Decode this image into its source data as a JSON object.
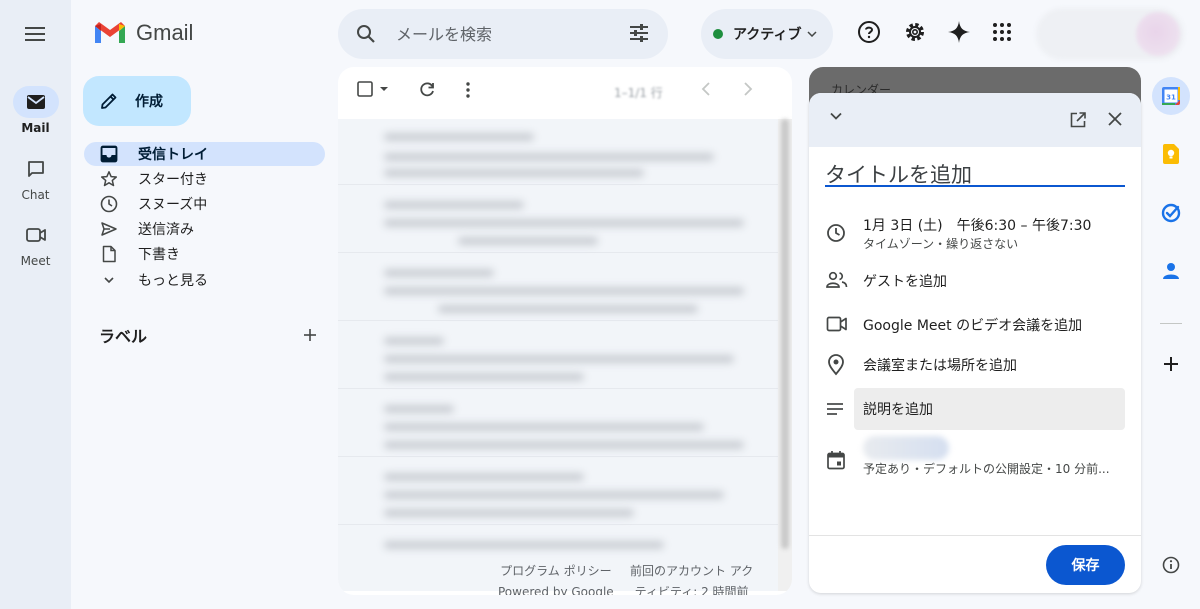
{
  "app": {
    "name": "Gmail"
  },
  "left_rail": {
    "items": [
      {
        "label": "Mail",
        "icon": "mail-icon"
      },
      {
        "label": "Chat",
        "icon": "chat-icon"
      },
      {
        "label": "Meet",
        "icon": "meet-icon"
      }
    ]
  },
  "search": {
    "placeholder": "メールを検索"
  },
  "status": {
    "label": "アクティブ",
    "color": "#1e8e3e"
  },
  "compose": {
    "label": "作成"
  },
  "nav": {
    "items": [
      {
        "label": "受信トレイ",
        "icon": "inbox-icon"
      },
      {
        "label": "スター付き",
        "icon": "star-icon"
      },
      {
        "label": "スヌーズ中",
        "icon": "clock-icon"
      },
      {
        "label": "送信済み",
        "icon": "send-icon"
      },
      {
        "label": "下書き",
        "icon": "draft-icon"
      },
      {
        "label": "もっと見る",
        "icon": "chevron-down-icon"
      }
    ],
    "labels_header": "ラベル"
  },
  "mail_list": {
    "footer": {
      "policy_line1": "プログラム ポリシー",
      "policy_line2": "Powered by Google",
      "activity_line1": "前回のアカウント アク",
      "activity_line2": "ティビティ: 2 時間前"
    }
  },
  "calendar": {
    "header_title": "カレンダー",
    "title_placeholder": "タイトルを追加",
    "datetime": "1月 3日 (土)　午後6:30 – 午後7:30",
    "datetime_sub": "タイムゾーン・繰り返さない",
    "add_guests": "ゲストを追加",
    "add_meet": "Google Meet のビデオ会議を追加",
    "add_location": "会議室または場所を追加",
    "add_description": "説明を追加",
    "calendar_sub": "予定あり・デフォルトの公開設定・10 分前...",
    "save_label": "保存"
  },
  "colors": {
    "accent": "#0b57d0",
    "compose_bg": "#c2e7ff",
    "nav_active_bg": "#d3e3fd"
  }
}
